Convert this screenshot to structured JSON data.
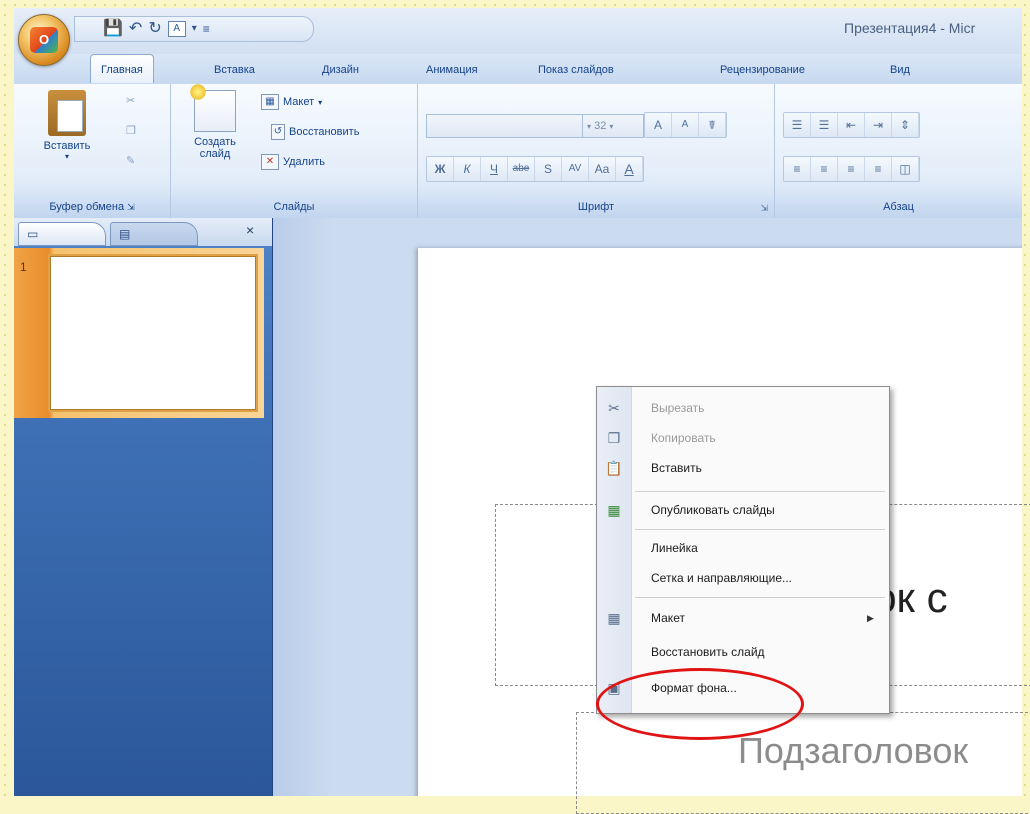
{
  "window": {
    "title": "Презентация4 - Micr"
  },
  "office_button": {
    "logo": "O"
  },
  "quick_access": {
    "save_icon": "save-icon",
    "undo_icon": "undo-icon",
    "redo_icon": "redo-icon",
    "font_icon_label": "A"
  },
  "tabs": [
    {
      "label": "Главная",
      "active": true
    },
    {
      "label": "Вставка"
    },
    {
      "label": "Дизайн"
    },
    {
      "label": "Анимация"
    },
    {
      "label": "Показ слайдов"
    },
    {
      "label": "Рецензирование"
    },
    {
      "label": "Вид"
    }
  ],
  "ribbon": {
    "clipboard": {
      "label": "Буфер обмена",
      "paste": "Вставить"
    },
    "slides": {
      "label": "Слайды",
      "new_slide_line1": "Создать",
      "new_slide_line2": "слайд",
      "layout": "Макет",
      "reset": "Восстановить",
      "delete": "Удалить"
    },
    "font": {
      "label": "Шрифт",
      "size": "32",
      "grow": "A",
      "shrink": "A",
      "bold": "Ж",
      "italic": "К",
      "underline": "Ч",
      "strike": "abe",
      "shadow": "S",
      "spacing": "AV",
      "case": "Aa",
      "color": "A"
    },
    "paragraph": {
      "label": "Абзац"
    }
  },
  "slide_pane": {
    "slide_number": "1"
  },
  "slide": {
    "title_fragment": "овок с",
    "subtitle_fragment": "Подзаголовок"
  },
  "context_menu": {
    "items": [
      {
        "label": "Вырезать",
        "disabled": true,
        "icon": "cut-icon"
      },
      {
        "label": "Копировать",
        "disabled": true,
        "icon": "copy-icon"
      },
      {
        "label": "Вставить",
        "icon": "paste-icon"
      },
      {
        "label": "Опубликовать слайды",
        "icon": "publish-icon"
      },
      {
        "label": "Линейка"
      },
      {
        "label": "Сетка и направляющие..."
      },
      {
        "label": "Макет",
        "icon": "layout-icon",
        "submenu": true
      },
      {
        "label": "Восстановить слайд"
      },
      {
        "label": "Формат фона...",
        "icon": "format-background-icon"
      }
    ]
  },
  "colors": {
    "highlight": "#e01414",
    "ribbon_text": "#15428b",
    "selected_thumb": "#e98d2c"
  }
}
